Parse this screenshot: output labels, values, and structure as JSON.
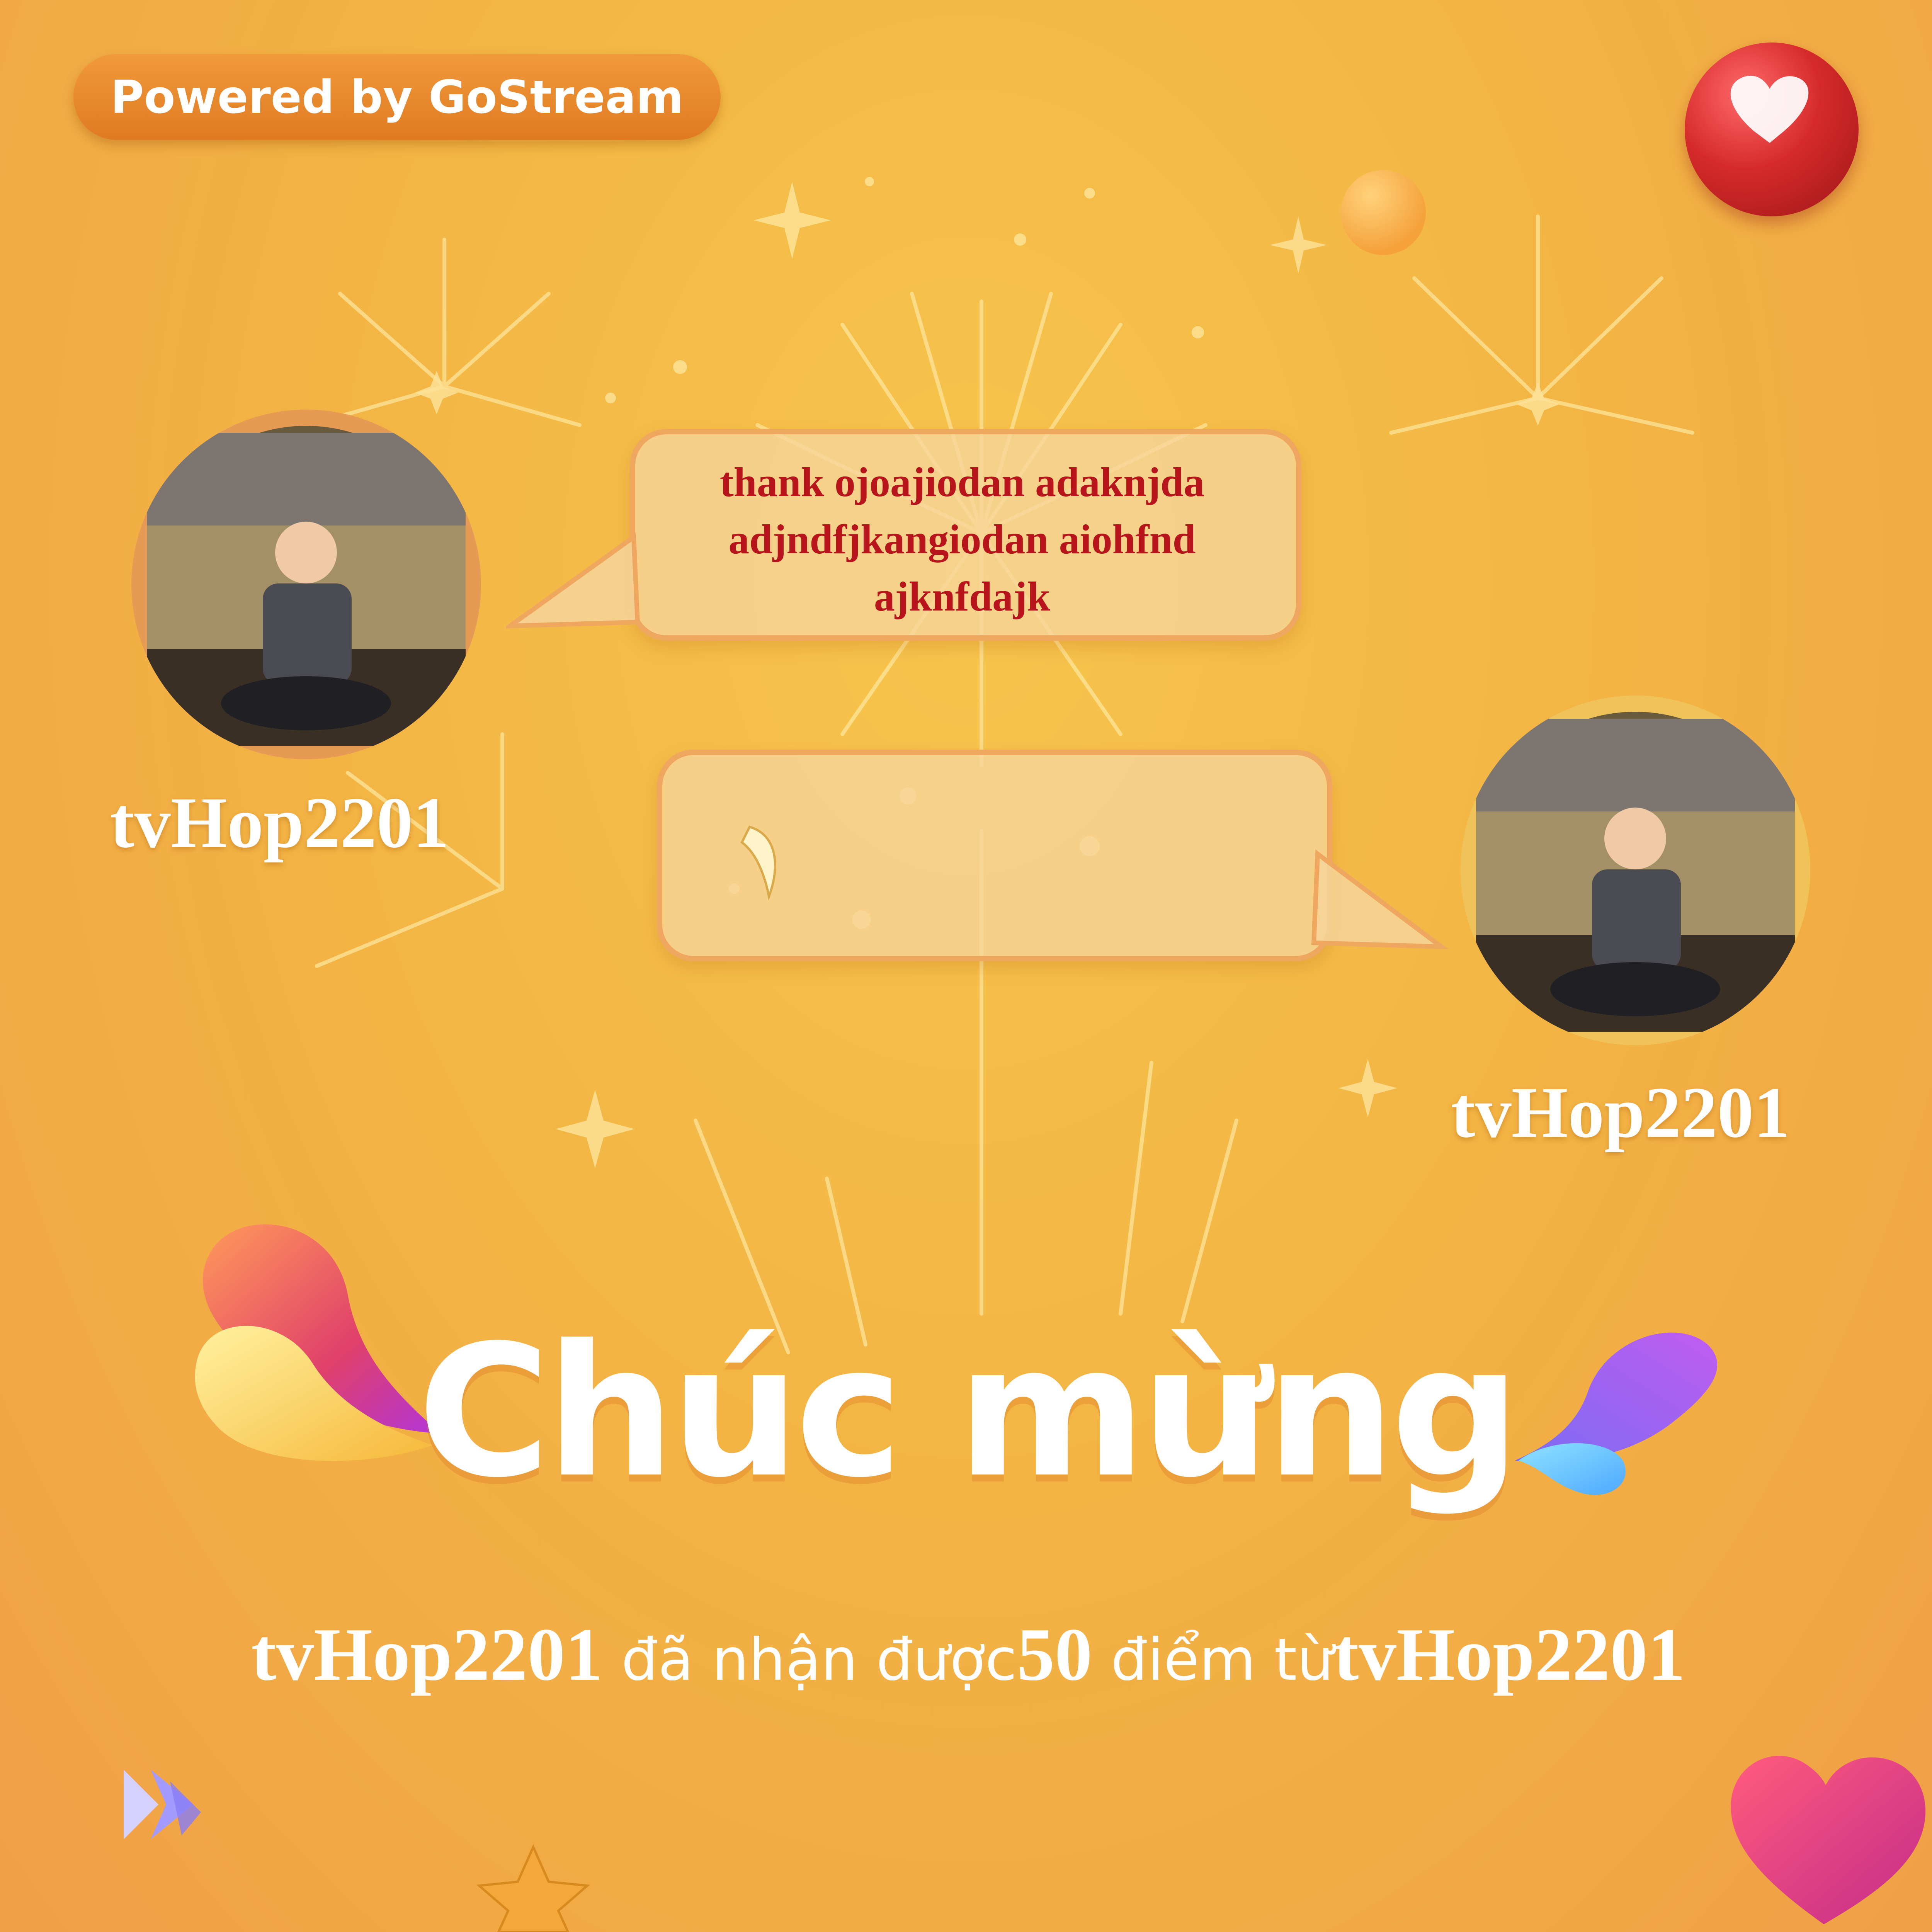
{
  "brand": {
    "powered_by": "Powered by GoStream"
  },
  "messages": [
    {
      "sender": "tvHop2201",
      "text": "thank ojoajiodan adaknjda\nadjndfjkangiodan aiohfnd\najknfdajk"
    },
    {
      "sender": "tvHop2201",
      "text": ""
    }
  ],
  "title": "Chúc mừng",
  "notice": {
    "recipient": "tvHop2201",
    "text_before": " đã nhận được",
    "points": "50",
    "text_after": " điểm từ",
    "sender": "tvHop2201"
  },
  "colors": {
    "background": "#f3b544",
    "pill": "#e8882c",
    "message_text": "#b8141b",
    "bubble_border": "#efa65f"
  },
  "icons": [
    "heart-icon",
    "star-icon",
    "gostream-logo-icon",
    "sparkle-icon"
  ]
}
